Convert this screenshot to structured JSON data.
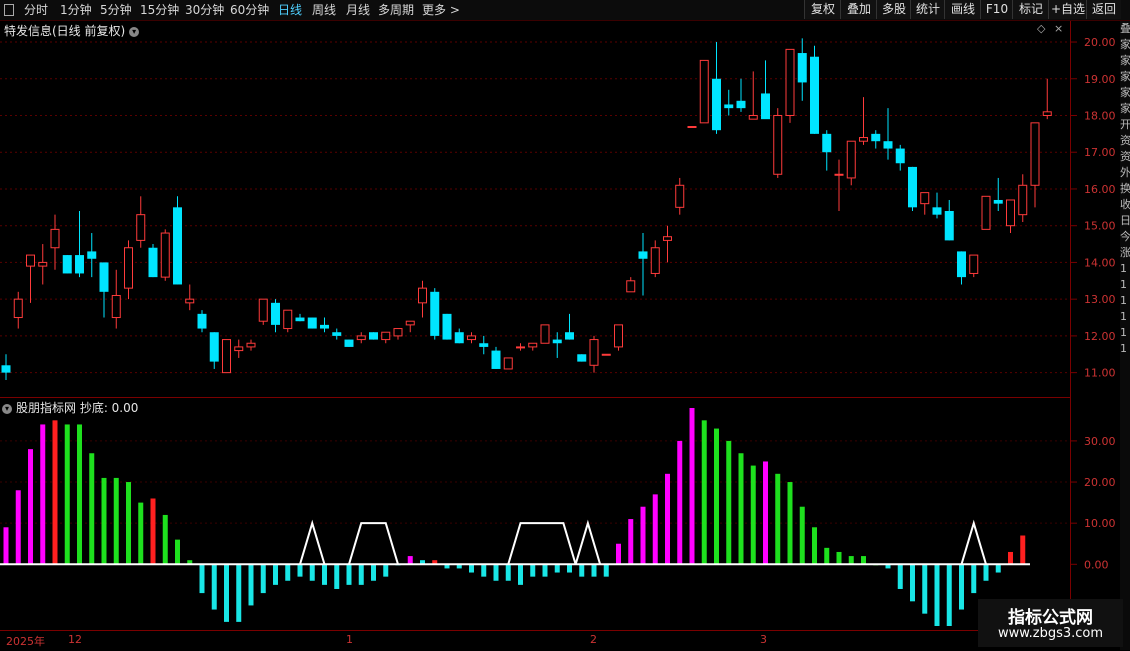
{
  "toolbar": {
    "left_items": [
      "分时",
      "1分钟",
      "5分钟",
      "15分钟",
      "30分钟",
      "60分钟",
      "日线",
      "周线",
      "月线",
      "多周期",
      "更多 >"
    ],
    "active": "日线",
    "right_items": [
      "复权",
      "叠加",
      "多股",
      "统计",
      "画线",
      "F10",
      "标记",
      "+自选",
      "返回"
    ]
  },
  "main_title": "特发信息(日线 前复权)",
  "price_axis": [
    "20.00",
    "19.00",
    "18.00",
    "17.00",
    "16.00",
    "15.00",
    "14.00",
    "13.00",
    "12.00",
    "11.00"
  ],
  "indicator": {
    "title": "股朋指标网 抄底: 0.00",
    "axis_labels": [
      "30.00",
      "20.00",
      "10.00",
      "0.00"
    ]
  },
  "date_axis": [
    "2025年",
    "12",
    "1",
    "2",
    "3"
  ],
  "watermark": {
    "line1": "指标公式网",
    "line2": "www.zbgs3.com"
  },
  "right_strip": [
    "叠",
    "家",
    "家",
    "家",
    "家",
    "家",
    "开",
    "资",
    "资",
    "外",
    "换",
    "收",
    "日",
    "今",
    "涨",
    "1",
    "1",
    "1",
    "1",
    "1",
    "1"
  ],
  "colors": {
    "up": "#ff3b3b",
    "down": "#00e5ff",
    "magenta": "#ff00ff",
    "green": "#1ee01e",
    "red": "#ff2020",
    "cyan": "#19e6e6",
    "line": "#ffffff"
  },
  "chart_data": [
    {
      "type": "candlestick",
      "title": "特发信息(日线 前复权)",
      "ylim": [
        10.5,
        20.3
      ],
      "candles": [
        [
          11.2,
          11.5,
          10.8,
          11.0
        ],
        [
          12.5,
          13.2,
          12.2,
          13.0
        ],
        [
          13.9,
          14.0,
          12.9,
          14.2
        ],
        [
          13.9,
          14.5,
          13.4,
          14.0
        ],
        [
          14.4,
          15.3,
          13.8,
          14.9
        ],
        [
          14.2,
          14.2,
          13.7,
          13.7
        ],
        [
          14.2,
          15.4,
          13.6,
          13.7
        ],
        [
          14.3,
          14.8,
          13.6,
          14.1
        ],
        [
          14.0,
          14.0,
          12.5,
          13.2
        ],
        [
          12.5,
          13.8,
          12.2,
          13.1
        ],
        [
          13.3,
          14.6,
          13.0,
          14.4
        ],
        [
          14.6,
          15.8,
          14.4,
          15.3
        ],
        [
          14.4,
          14.5,
          13.6,
          13.6
        ],
        [
          13.6,
          14.9,
          13.5,
          14.8
        ],
        [
          15.5,
          15.8,
          13.4,
          13.4
        ],
        [
          12.9,
          13.4,
          12.7,
          13.0
        ],
        [
          12.6,
          12.7,
          12.1,
          12.2
        ],
        [
          12.1,
          12.1,
          11.1,
          11.3
        ],
        [
          11.0,
          11.9,
          11.0,
          11.9
        ],
        [
          11.6,
          11.9,
          11.4,
          11.7
        ],
        [
          11.7,
          11.9,
          11.6,
          11.8
        ],
        [
          12.4,
          13.0,
          12.3,
          13.0
        ],
        [
          12.9,
          13.0,
          12.1,
          12.3
        ],
        [
          12.2,
          12.7,
          12.1,
          12.7
        ],
        [
          12.5,
          12.6,
          12.4,
          12.4
        ],
        [
          12.5,
          12.5,
          12.2,
          12.2
        ],
        [
          12.3,
          12.5,
          12.1,
          12.2
        ],
        [
          12.1,
          12.2,
          11.9,
          12.0
        ],
        [
          11.9,
          11.9,
          11.7,
          11.7
        ],
        [
          11.9,
          12.1,
          11.8,
          12.0
        ],
        [
          12.1,
          12.1,
          11.9,
          11.9
        ],
        [
          11.9,
          12.1,
          11.8,
          12.1
        ],
        [
          12.0,
          12.2,
          11.9,
          12.2
        ],
        [
          12.3,
          12.4,
          12.1,
          12.4
        ],
        [
          12.9,
          13.5,
          12.5,
          13.3
        ],
        [
          13.2,
          13.3,
          11.9,
          12.0
        ],
        [
          12.6,
          12.6,
          11.9,
          11.9
        ],
        [
          12.1,
          12.2,
          11.8,
          11.8
        ],
        [
          11.9,
          12.1,
          11.8,
          12.0
        ],
        [
          11.8,
          12.0,
          11.5,
          11.7
        ],
        [
          11.6,
          11.7,
          11.1,
          11.1
        ],
        [
          11.1,
          11.4,
          11.1,
          11.4
        ],
        [
          11.7,
          11.8,
          11.6,
          11.7
        ],
        [
          11.7,
          11.8,
          11.6,
          11.8
        ],
        [
          11.8,
          12.3,
          11.8,
          12.3
        ],
        [
          11.9,
          12.1,
          11.4,
          11.8
        ],
        [
          12.1,
          12.6,
          11.9,
          11.9
        ],
        [
          11.5,
          11.5,
          11.3,
          11.3
        ],
        [
          11.2,
          12.0,
          11.0,
          11.9
        ],
        [
          11.5,
          11.5,
          11.5,
          11.5
        ],
        [
          11.7,
          12.3,
          11.6,
          12.3
        ],
        [
          13.2,
          13.6,
          13.2,
          13.5
        ],
        [
          14.3,
          14.8,
          13.1,
          14.1
        ],
        [
          13.7,
          14.6,
          13.6,
          14.4
        ],
        [
          14.6,
          15.0,
          14.0,
          14.7
        ],
        [
          15.5,
          16.3,
          15.3,
          16.1
        ],
        [
          17.7,
          17.7,
          17.7,
          17.7
        ],
        [
          17.8,
          19.5,
          17.8,
          19.5
        ],
        [
          19.0,
          20.0,
          17.5,
          17.6
        ],
        [
          18.3,
          18.7,
          18.0,
          18.2
        ],
        [
          18.4,
          19.0,
          18.1,
          18.2
        ],
        [
          17.9,
          19.2,
          17.9,
          18.0
        ],
        [
          18.6,
          19.5,
          18.1,
          17.9
        ],
        [
          16.4,
          18.2,
          16.3,
          18.0
        ],
        [
          18.0,
          19.7,
          17.8,
          19.8
        ],
        [
          19.7,
          20.1,
          18.4,
          18.9
        ],
        [
          19.6,
          19.9,
          17.5,
          17.5
        ],
        [
          17.5,
          17.6,
          16.5,
          17.0
        ],
        [
          16.4,
          16.8,
          15.4,
          16.4
        ],
        [
          16.3,
          17.3,
          16.1,
          17.3
        ],
        [
          17.3,
          18.5,
          17.2,
          17.4
        ],
        [
          17.5,
          17.6,
          17.1,
          17.3
        ],
        [
          17.3,
          18.2,
          16.8,
          17.1
        ],
        [
          17.1,
          17.2,
          16.5,
          16.7
        ],
        [
          16.6,
          16.6,
          15.4,
          15.5
        ],
        [
          15.6,
          15.8,
          15.3,
          15.9
        ],
        [
          15.5,
          15.9,
          15.2,
          15.3
        ],
        [
          15.4,
          15.7,
          14.6,
          14.6
        ],
        [
          14.3,
          14.3,
          13.4,
          13.6
        ],
        [
          13.7,
          14.1,
          13.6,
          14.2
        ],
        [
          14.9,
          15.5,
          14.9,
          15.8
        ],
        [
          15.7,
          16.3,
          15.4,
          15.6
        ],
        [
          15.0,
          15.2,
          14.8,
          15.7
        ],
        [
          15.3,
          16.4,
          15.1,
          16.1
        ],
        [
          16.1,
          17.8,
          15.5,
          17.8
        ],
        [
          18.0,
          19.0,
          17.9,
          18.1
        ]
      ]
    },
    {
      "type": "bar",
      "title": "股朋指标网 抄底: 0.00",
      "ylim": [
        -15,
        38
      ],
      "values": [
        9,
        18,
        28,
        34,
        35,
        34,
        34,
        27,
        21,
        21,
        20,
        15,
        16,
        12,
        6,
        1,
        -7,
        -11,
        -14,
        -14,
        -10,
        -7,
        -5,
        -4,
        -3,
        -4,
        -5,
        -6,
        -5,
        -5,
        -4,
        -3,
        0,
        2,
        1,
        1,
        -1,
        -1,
        -2,
        -3,
        -4,
        -4,
        -5,
        -3,
        -3,
        -2,
        -2,
        -3,
        -3,
        -3,
        5,
        11,
        14,
        17,
        22,
        30,
        38,
        35,
        33,
        30,
        27,
        24,
        25,
        22,
        20,
        14,
        9,
        4,
        3,
        2,
        2,
        0,
        -1,
        -6,
        -9,
        -12,
        -15,
        -15,
        -11,
        -7,
        -4,
        -2,
        3,
        7
      ],
      "colors": [
        "m",
        "m",
        "m",
        "m",
        "r",
        "g",
        "g",
        "g",
        "g",
        "g",
        "g",
        "g",
        "r",
        "g",
        "g",
        "g",
        "c",
        "c",
        "c",
        "c",
        "c",
        "c",
        "c",
        "c",
        "c",
        "c",
        "c",
        "c",
        "c",
        "c",
        "c",
        "c",
        "c",
        "m",
        "c",
        "r",
        "c",
        "c",
        "c",
        "c",
        "c",
        "c",
        "c",
        "c",
        "c",
        "c",
        "c",
        "c",
        "c",
        "c",
        "m",
        "m",
        "m",
        "m",
        "m",
        "m",
        "m",
        "g",
        "g",
        "g",
        "g",
        "g",
        "m",
        "g",
        "g",
        "g",
        "g",
        "g",
        "g",
        "g",
        "g",
        "g",
        "c",
        "c",
        "c",
        "c",
        "c",
        "c",
        "c",
        "c",
        "c",
        "c",
        "r",
        "r"
      ],
      "line_segments": [
        {
          "x": [
            24.0,
            25.0,
            26.0
          ],
          "y": [
            0,
            10,
            0
          ]
        },
        {
          "x": [
            28.0,
            29.0,
            31.0,
            32.0
          ],
          "y": [
            0,
            10,
            10,
            0
          ]
        },
        {
          "x": [
            41.0,
            42.0,
            45.5,
            46.5
          ],
          "y": [
            0,
            10,
            10,
            0
          ]
        },
        {
          "x": [
            46.5,
            47.5,
            48.5
          ],
          "y": [
            0,
            10,
            0
          ]
        },
        {
          "x": [
            78.0,
            79.0,
            80.0
          ],
          "y": [
            0,
            10,
            0
          ]
        }
      ]
    }
  ]
}
